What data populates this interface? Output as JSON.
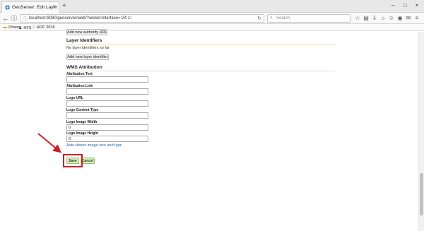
{
  "browser": {
    "tab_title": "GeoServer: Edit Layer",
    "tab_close": "×",
    "new_tab": "+",
    "window_controls": [
      "–",
      "□",
      "×"
    ],
    "url": "localhost:8080/geoserver/web/?wicket:interface=:24:1::",
    "search_placeholder": "Search",
    "bookmarks": [
      {
        "label": "Others",
        "icon": "folder-icon"
      },
      {
        "label": "HFS",
        "icon": "people-icon"
      },
      {
        "label": "HOC 2016",
        "icon": "page-icon"
      }
    ],
    "toolbar_icons": [
      "star-icon",
      "reading-list-icon",
      "download-icon",
      "home-icon",
      "chat-icon",
      "pocket-icon",
      "extensions-icon",
      "menu-icon"
    ]
  },
  "form": {
    "add_authority_url_label": "Add new authority URL",
    "layer_identifiers": {
      "heading": "Layer Identifiers",
      "empty_note": "No layer identifiers so far",
      "add_button_label": "Add new layer identifier"
    },
    "wms_attribution": {
      "heading": "WMS Attribution",
      "attribution_text_label": "Attribution Text",
      "attribution_text_value": "",
      "attribution_link_label": "Attribution Link",
      "attribution_link_value": "",
      "logo_url_label": "Logo URL",
      "logo_url_value": "",
      "logo_content_type_label": "Logo Content Type",
      "logo_content_type_value": "",
      "logo_image_width_label": "Logo Image Width",
      "logo_image_width_value": "0",
      "logo_image_height_label": "Logo Image Height",
      "logo_image_height_value": "0",
      "auto_detect_link": "Auto-detect image size and type"
    },
    "save_label": "Save",
    "cancel_label": "Cancel"
  },
  "colors": {
    "annotation_red": "#c8202a",
    "link_blue": "#2266aa",
    "save_green": "#d9efc0"
  }
}
